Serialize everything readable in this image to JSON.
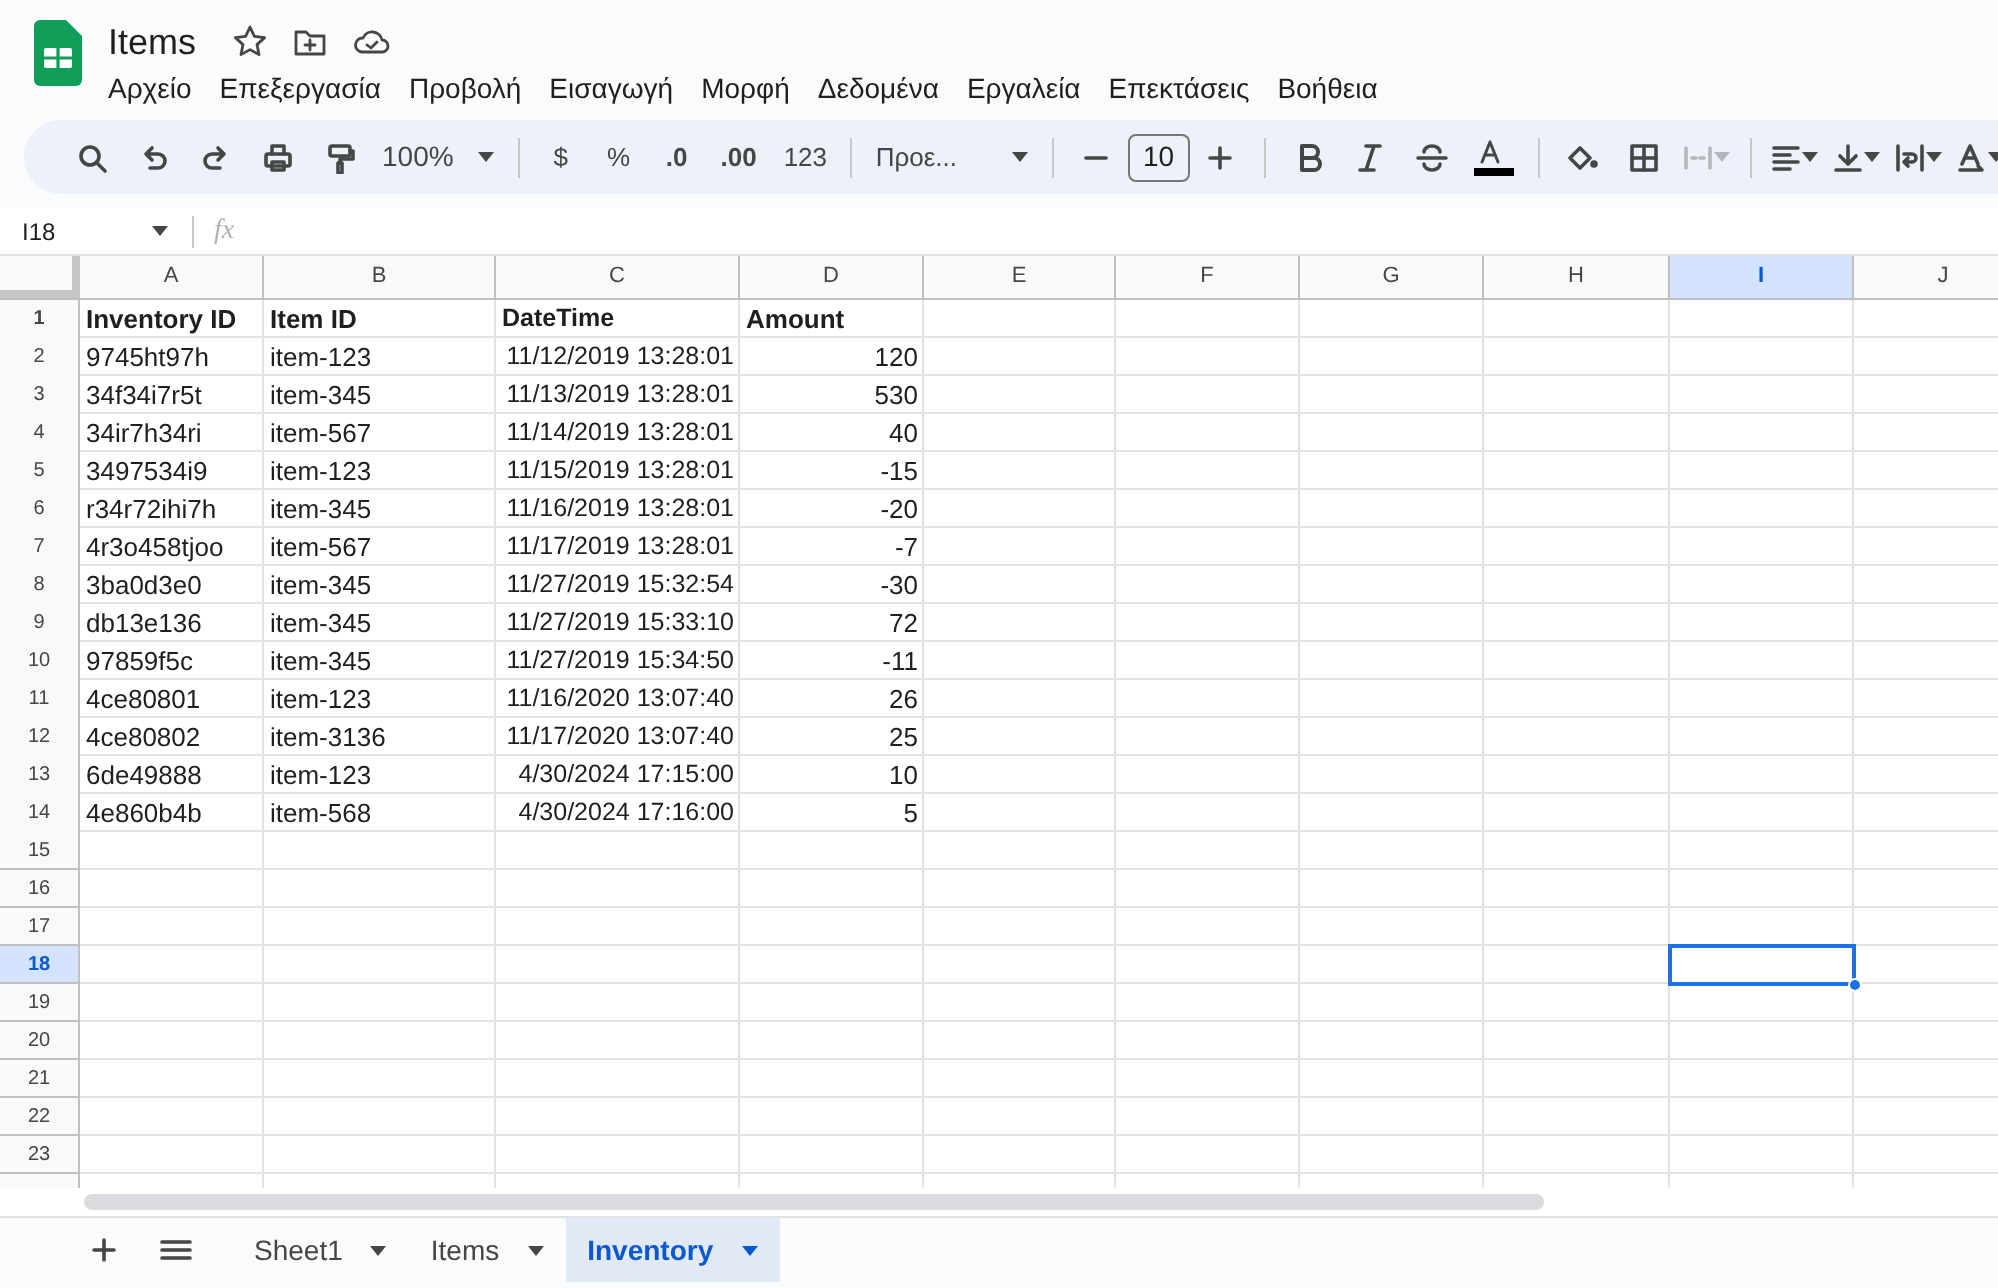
{
  "document": {
    "title": "Items"
  },
  "menu": [
    "Αρχείο",
    "Επεξεργασία",
    "Προβολή",
    "Εισαγωγή",
    "Μορφή",
    "Δεδομένα",
    "Εργαλεία",
    "Επεκτάσεις",
    "Βοήθεια"
  ],
  "toolbar": {
    "zoom": "100%",
    "currency": "$",
    "percent": "%",
    "decrease_decimals": ".0",
    "increase_decimals": ".00",
    "number_format": "123",
    "font": "Προε...",
    "font_size": "10"
  },
  "formula_bar": {
    "name_box": "I18",
    "fx": "fx"
  },
  "columns": [
    {
      "label": "A",
      "selected": false
    },
    {
      "label": "B",
      "selected": false
    },
    {
      "label": "C",
      "selected": false
    },
    {
      "label": "D",
      "selected": false
    },
    {
      "label": "E",
      "selected": false
    },
    {
      "label": "F",
      "selected": false
    },
    {
      "label": "G",
      "selected": false
    },
    {
      "label": "H",
      "selected": false
    },
    {
      "label": "I",
      "selected": true
    },
    {
      "label": "J",
      "selected": false
    }
  ],
  "rows": [
    {
      "number": "1",
      "selected": false,
      "kind": "header",
      "cells": [
        "Inventory ID",
        "Item ID",
        "DateTime",
        "Amount"
      ]
    },
    {
      "number": "2",
      "selected": false,
      "kind": "data",
      "cells": [
        "9745ht97h",
        "item-123",
        "11/12/2019 13:28:01",
        "120"
      ]
    },
    {
      "number": "3",
      "selected": false,
      "kind": "data",
      "cells": [
        "34f34i7r5t",
        "item-345",
        "11/13/2019 13:28:01",
        "530"
      ]
    },
    {
      "number": "4",
      "selected": false,
      "kind": "data",
      "cells": [
        "34ir7h34ri",
        "item-567",
        "11/14/2019 13:28:01",
        "40"
      ]
    },
    {
      "number": "5",
      "selected": false,
      "kind": "data",
      "cells": [
        "3497534i9",
        "item-123",
        "11/15/2019 13:28:01",
        "-15"
      ]
    },
    {
      "number": "6",
      "selected": false,
      "kind": "data",
      "cells": [
        "r34r72ihi7h",
        "item-345",
        "11/16/2019 13:28:01",
        "-20"
      ]
    },
    {
      "number": "7",
      "selected": false,
      "kind": "data",
      "cells": [
        "4r3o458tjoo",
        "item-567",
        "11/17/2019 13:28:01",
        "-7"
      ]
    },
    {
      "number": "8",
      "selected": false,
      "kind": "data",
      "cells": [
        "3ba0d3e0",
        "item-345",
        "11/27/2019 15:32:54",
        "-30"
      ]
    },
    {
      "number": "9",
      "selected": false,
      "kind": "data",
      "cells": [
        "db13e136",
        "item-345",
        "11/27/2019 15:33:10",
        "72"
      ]
    },
    {
      "number": "10",
      "selected": false,
      "kind": "data",
      "cells": [
        "97859f5c",
        "item-345",
        "11/27/2019 15:34:50",
        "-11"
      ]
    },
    {
      "number": "11",
      "selected": false,
      "kind": "data",
      "cells": [
        "4ce80801",
        "item-123",
        "11/16/2020 13:07:40",
        "26"
      ]
    },
    {
      "number": "12",
      "selected": false,
      "kind": "data",
      "cells": [
        "4ce80802",
        "item-3136",
        "11/17/2020 13:07:40",
        "25"
      ]
    },
    {
      "number": "13",
      "selected": false,
      "kind": "data",
      "cells": [
        "6de49888",
        "item-123",
        "4/30/2024 17:15:00",
        "10"
      ]
    },
    {
      "number": "14",
      "selected": false,
      "kind": "data",
      "cells": [
        "4e860b4b",
        "item-568",
        "4/30/2024 17:16:00",
        "5"
      ]
    },
    {
      "number": "15",
      "selected": false,
      "kind": "data"
    },
    {
      "number": "16",
      "selected": false,
      "kind": "data"
    },
    {
      "number": "17",
      "selected": false,
      "kind": "data"
    },
    {
      "number": "18",
      "selected": true,
      "kind": "data"
    },
    {
      "number": "19",
      "selected": false,
      "kind": "data"
    },
    {
      "number": "20",
      "selected": false,
      "kind": "data"
    },
    {
      "number": "21",
      "selected": false,
      "kind": "data"
    },
    {
      "number": "22",
      "selected": false,
      "kind": "data"
    },
    {
      "number": "23",
      "selected": false,
      "kind": "data"
    }
  ],
  "sheet_tabs": [
    {
      "label": "Sheet1",
      "selected": false
    },
    {
      "label": "Items",
      "selected": false
    },
    {
      "label": "Inventory",
      "selected": true
    }
  ]
}
